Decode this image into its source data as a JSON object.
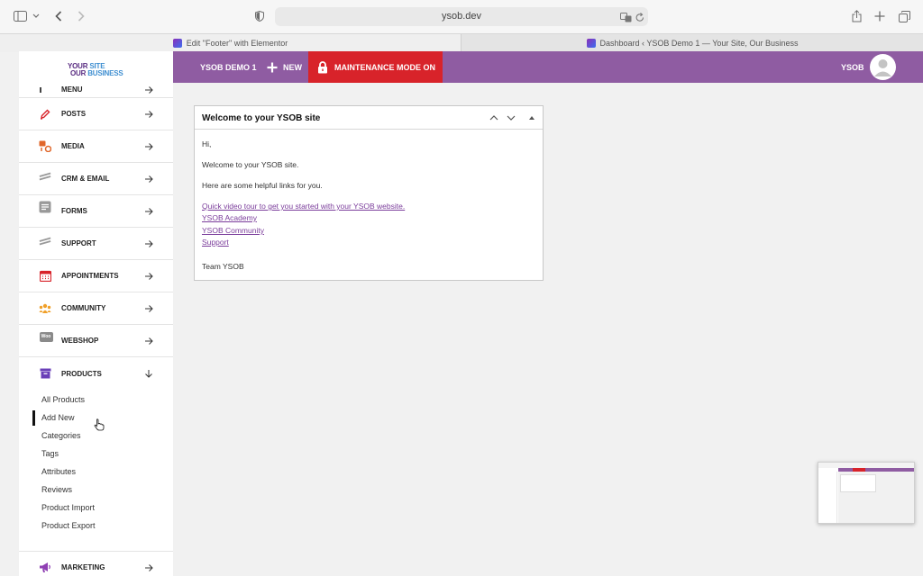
{
  "browser": {
    "url": "ysob.dev",
    "tabs": [
      {
        "title": "Edit \"Footer\" with Elementor"
      },
      {
        "title": "Dashboard ‹ YSOB Demo 1 — Your Site, Our Business"
      }
    ]
  },
  "logo": {
    "line1a": "YOUR ",
    "line1b": "SITE",
    "line2a": "OUR ",
    "line2b": "BUSINESS"
  },
  "adminbar": {
    "site_name": "YSOB DEMO 1",
    "new_label": "NEW",
    "maintenance_label": "MAINTENANCE MODE ON",
    "user_label": "YSOB"
  },
  "sidebar": {
    "items": [
      {
        "label": "MENU"
      },
      {
        "label": "POSTS"
      },
      {
        "label": "MEDIA"
      },
      {
        "label": "CRM & EMAIL"
      },
      {
        "label": "FORMS"
      },
      {
        "label": "SUPPORT"
      },
      {
        "label": "APPOINTMENTS"
      },
      {
        "label": "COMMUNITY"
      },
      {
        "label": "WEBSHOP"
      },
      {
        "label": "PRODUCTS"
      },
      {
        "label": "MARKETING"
      }
    ],
    "products_submenu": [
      "All Products",
      "Add New",
      "Categories",
      "Tags",
      "Attributes",
      "Reviews",
      "Product Import",
      "Product Export"
    ],
    "webshop_badge": "Woo"
  },
  "widget": {
    "title": "Welcome to your YSOB site",
    "greeting": "Hi,",
    "line1": "Welcome to your YSOB site.",
    "line2": "Here are some helpful links for you.",
    "links": [
      "Quick video tour to get you started with your YSOB website.",
      "YSOB Academy",
      "YSOB Community",
      "Support"
    ],
    "signoff": "Team YSOB"
  },
  "colors": {
    "adminbar": "#8f5ca2",
    "maintenance": "#d8232a",
    "link": "#7b3d9b"
  }
}
